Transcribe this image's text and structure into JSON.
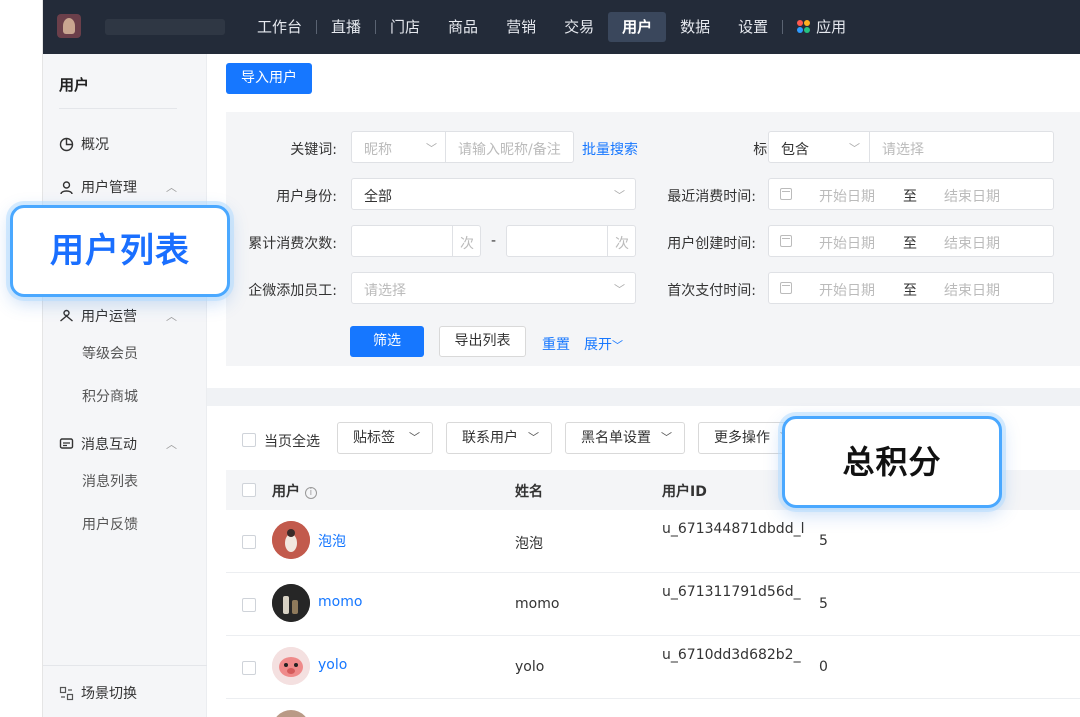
{
  "topnav": {
    "items": [
      "工作台",
      "直播",
      "门店",
      "商品",
      "营销",
      "交易",
      "用户",
      "数据",
      "设置",
      "应用"
    ],
    "active": "用户"
  },
  "sidebar": {
    "title": "用户",
    "groups": [
      {
        "label": "概况"
      },
      {
        "label": "用户管理"
      },
      {
        "label": "用户运营",
        "items": [
          "等级会员",
          "积分商城"
        ]
      },
      {
        "label": "消息互动",
        "items": [
          "消息列表",
          "用户反馈"
        ]
      }
    ],
    "footer": "场景切换"
  },
  "toolbar": {
    "import_label": "导入用户"
  },
  "filters": {
    "keyword_label": "关键词:",
    "keyword_type": "昵称",
    "keyword_placeholder": "请输入昵称/备注",
    "batch_search": "批量搜索",
    "tag_label": "标签:",
    "tag_mode": "包含",
    "tag_placeholder": "请选择",
    "identity_label": "用户身份:",
    "identity_value": "全部",
    "count_label": "累计消费次数:",
    "count_unit": "次",
    "count_sep": "-",
    "staff_label": "企微添加员工:",
    "staff_placeholder": "请选择",
    "last_consume_label": "最近消费时间:",
    "created_label": "用户创建时间:",
    "first_pay_label": "首次支付时间:",
    "date_start": "开始日期",
    "date_to": "至",
    "date_end": "结束日期",
    "filter_btn": "筛选",
    "export_btn": "导出列表",
    "reset": "重置",
    "expand": "展开"
  },
  "list": {
    "select_page": "当页全选",
    "actions": [
      "贴标签",
      "联系用户",
      "黑名单设置",
      "更多操作"
    ],
    "columns": {
      "user": "用户",
      "name": "姓名",
      "id": "用户ID"
    },
    "rows": [
      {
        "user": "泡泡",
        "name": "泡泡",
        "id": "u_671344871dbdd_l",
        "points": "5"
      },
      {
        "user": "momo",
        "name": "momo",
        "id": "u_671311791d56d_",
        "points": "5"
      },
      {
        "user": "yolo",
        "name": "yolo",
        "id": "u_6710dd3d682b2_",
        "points": "0"
      }
    ]
  },
  "callouts": {
    "user_list": "用户列表",
    "total_points": "总积分"
  }
}
